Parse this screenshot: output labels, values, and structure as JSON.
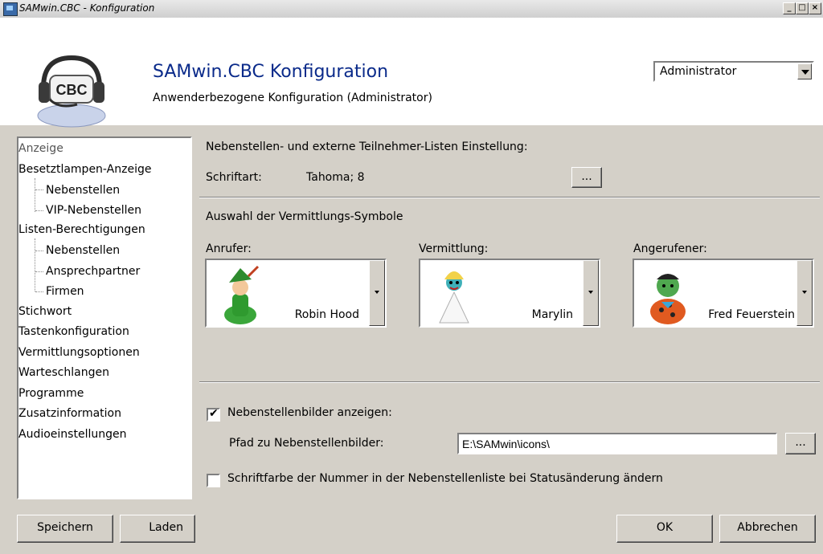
{
  "window": {
    "title": "SAMwin.CBC - Konfiguration",
    "buttons": {
      "minimize": "_",
      "maximize": "□",
      "close": "×"
    }
  },
  "header": {
    "logo_text": "CBC",
    "title": "SAMwin.CBC Konfiguration",
    "subtitle": "Anwenderbezogene Konfiguration (Administrator)",
    "role_select": {
      "value": "Administrator"
    }
  },
  "tree": {
    "items": [
      {
        "label": "Anzeige",
        "level": 0,
        "selected": true
      },
      {
        "label": "Besetztlampen-Anzeige",
        "level": 0
      },
      {
        "label": "Nebenstellen",
        "level": 1
      },
      {
        "label": "VIP-Nebenstellen",
        "level": 1
      },
      {
        "label": "Listen-Berechtigungen",
        "level": 0
      },
      {
        "label": "Nebenstellen",
        "level": 1
      },
      {
        "label": "Ansprechpartner",
        "level": 1
      },
      {
        "label": "Firmen",
        "level": 1
      },
      {
        "label": "Stichwort",
        "level": 0
      },
      {
        "label": "Tastenkonfiguration",
        "level": 0
      },
      {
        "label": "Vermittlungsoptionen",
        "level": 0
      },
      {
        "label": "Warteschlangen",
        "level": 0
      },
      {
        "label": "Programme",
        "level": 0
      },
      {
        "label": "Zusatzinformation",
        "level": 0
      },
      {
        "label": "Audioeinstellungen",
        "level": 0
      }
    ]
  },
  "display": {
    "list_section_title": "Nebenstellen- und externe Teilnehmer-Listen Einstellung:",
    "font_label": "Schriftart:",
    "font_value": "Tahoma; 8",
    "font_browse": "...",
    "symbols_section_title": "Auswahl der Vermittlungs-Symbole",
    "caller": {
      "label": "Anrufer:",
      "value": "Robin Hood"
    },
    "switching": {
      "label": "Vermittlung:",
      "value": "Marylin"
    },
    "callee": {
      "label": "Angerufener:",
      "value": "Fred Feuerstein"
    },
    "show_images": {
      "label": "Nebenstellenbilder anzeigen:",
      "checked": true
    },
    "image_path": {
      "label": "Pfad zu Nebenstellenbilder:",
      "value": "E:\\SAMwin\\icons\\",
      "browse": "..."
    },
    "font_color_change": {
      "label": "Schriftfarbe der Nummer in der Nebenstellenliste bei Statusänderung ändern",
      "checked": false
    }
  },
  "footer": {
    "save": "Speichern",
    "load": "Laden",
    "ok": "OK",
    "cancel": "Abbrechen"
  },
  "colors": {
    "header_title": "#0a2a8a",
    "face": "#d4d0c8"
  },
  "icons": [
    "app-icon",
    "cbc-logo-icon",
    "robin-hood-avatar",
    "marylin-avatar",
    "fred-feuerstein-avatar"
  ]
}
